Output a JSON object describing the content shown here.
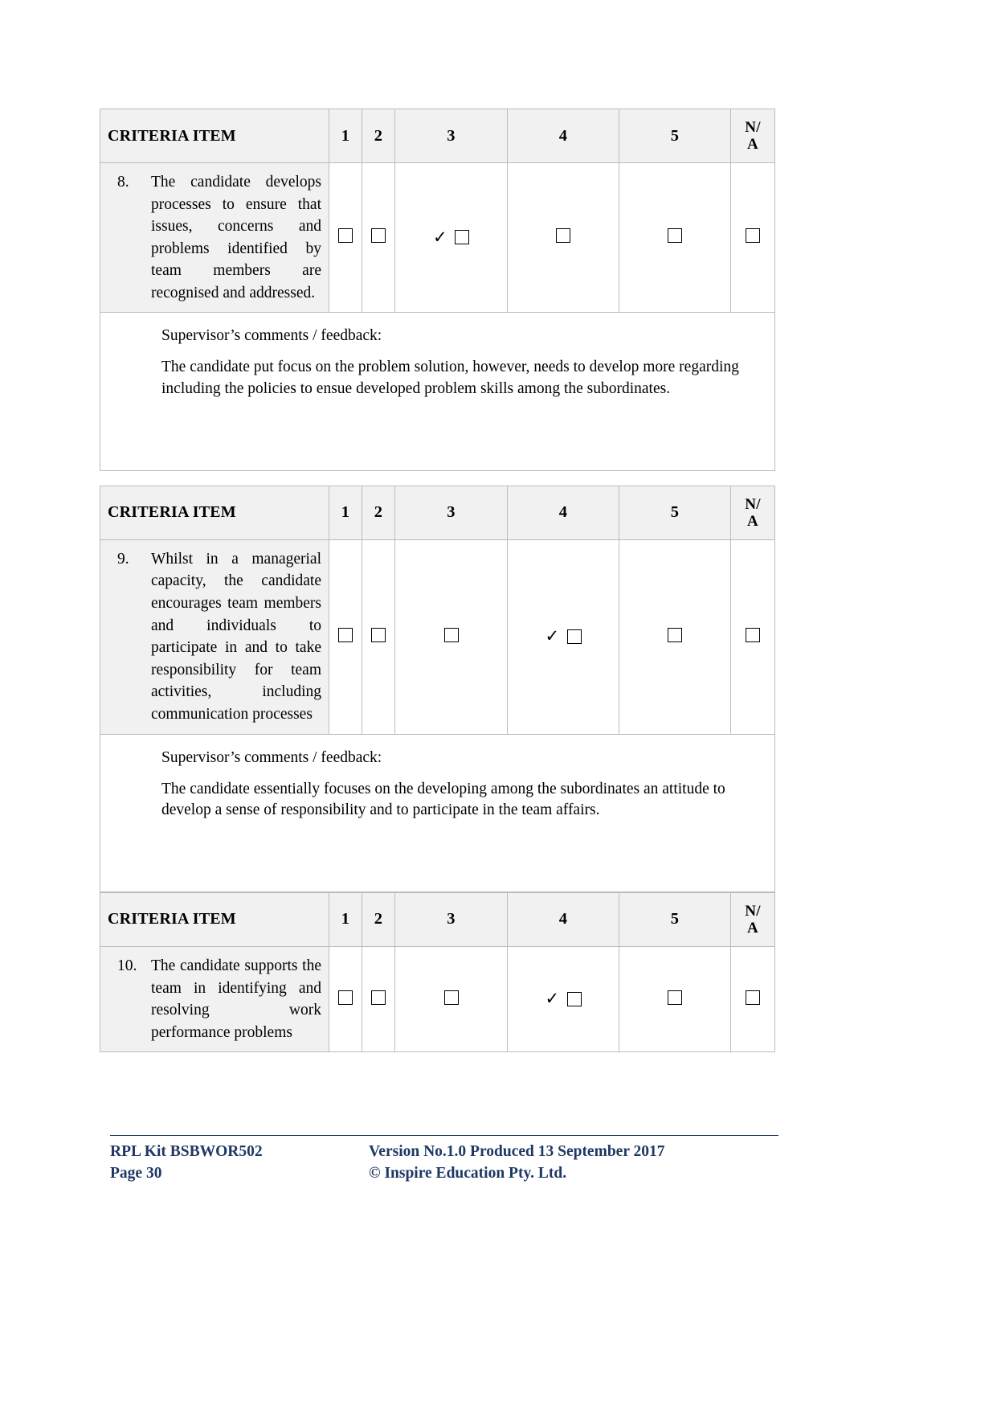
{
  "table": {
    "header": {
      "item_label": "CRITERIA ITEM",
      "scale": [
        "1",
        "2",
        "3",
        "4",
        "5"
      ],
      "na_line1": "N/",
      "na_line2": "A",
      "na_full": "N/A"
    }
  },
  "blocks": [
    {
      "number": "8.",
      "criteria": "The candidate develops processes to ensure that issues, concerns and problems identified by team members are recognised and addressed.",
      "selected_column": "3",
      "comments_label": "Supervisor’s comments / feedback:",
      "comments_text": "The candidate put focus on the problem solution, however, needs to develop more regarding including the policies to ensue developed problem skills among the subordinates.",
      "has_comments": true
    },
    {
      "number": "9.",
      "criteria": "Whilst in a managerial capacity, the candidate encourages team members and individuals to participate in and to take responsibility for team activities, including communication processes",
      "selected_column": "4",
      "comments_label": "Supervisor’s comments / feedback:",
      "comments_text": "The candidate essentially focuses on the developing among the subordinates an attitude to develop a sense of responsibility and to participate in the team affairs.",
      "has_comments": true
    },
    {
      "number": "10.",
      "criteria": "The candidate supports the team in identifying and resolving work performance problems",
      "selected_column": "4",
      "comments_label": "",
      "comments_text": "",
      "has_comments": false
    }
  ],
  "footer": {
    "left_line1": "RPL Kit BSBWOR502",
    "left_line2": "Page 30",
    "right_line1": "Version No.1.0 Produced 13 September 2017",
    "right_line2": "© Inspire Education Pty. Ltd.",
    "color": "#1f3864"
  },
  "colors": {
    "header_fill": "#f1f1f1",
    "criteria_fill": "#f1f1f1",
    "border": "#b8bcc0",
    "checkbox_border": "#000000",
    "page_bg": "#ffffff",
    "footer_text": "#1f3864"
  },
  "icons": {
    "tick": "✓",
    "checkbox": "checkbox-empty"
  }
}
